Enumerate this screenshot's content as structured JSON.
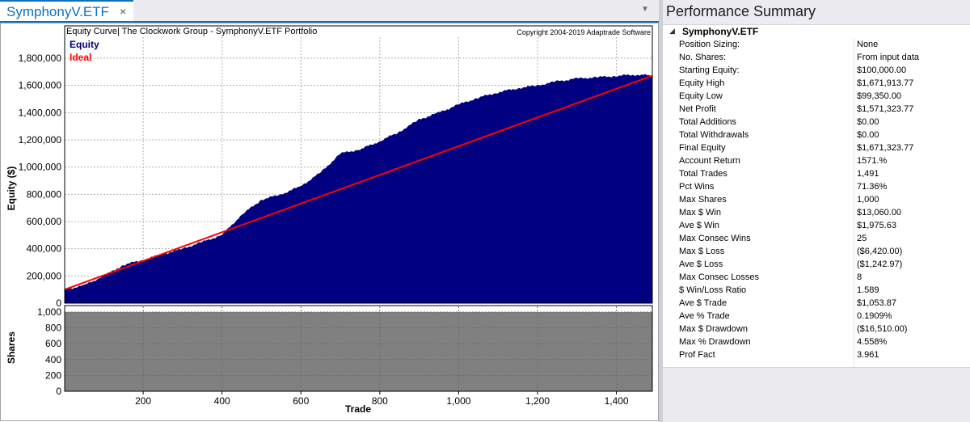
{
  "document_tab": {
    "title": "SymphonyV.ETF",
    "close_glyph": "×",
    "dropdown_glyph": "▼"
  },
  "colors": {
    "equity_fill": "#000080",
    "ideal_line": "#ff0000",
    "shares_fill": "#808080",
    "accent": "#0e70c0"
  },
  "chart_data": [
    {
      "type": "area",
      "title": "Equity Curve| The Clockwork Group - SymphonyV.ETF Portfolio",
      "copyright": "Copyright 2004-2019 Adaptrade Software",
      "xlabel": "",
      "ylabel": "Equity ($)",
      "xlim": [
        1,
        1491
      ],
      "ylim": [
        0,
        1800000
      ],
      "y_tick_labels": [
        "0",
        "200,000",
        "400,000",
        "600,000",
        "800,000",
        "1,000,000",
        "1,200,000",
        "1,400,000",
        "1,600,000",
        "1,800,000"
      ],
      "y_ticks": [
        0,
        200000,
        400000,
        600000,
        800000,
        1000000,
        1200000,
        1400000,
        1600000,
        1800000
      ],
      "grid": true,
      "legend": "top-left",
      "series": [
        {
          "name": "Equity",
          "x": [
            1,
            50,
            100,
            150,
            200,
            250,
            300,
            350,
            400,
            450,
            500,
            550,
            600,
            650,
            700,
            750,
            800,
            850,
            900,
            950,
            1000,
            1050,
            1100,
            1150,
            1200,
            1250,
            1300,
            1350,
            1400,
            1450,
            1491
          ],
          "values": [
            100000,
            130000,
            200000,
            280000,
            320000,
            360000,
            400000,
            450000,
            500000,
            650000,
            760000,
            800000,
            860000,
            960000,
            1100000,
            1130000,
            1190000,
            1260000,
            1350000,
            1400000,
            1460000,
            1510000,
            1550000,
            1580000,
            1600000,
            1630000,
            1650000,
            1660000,
            1670000,
            1680000,
            1671914
          ]
        },
        {
          "name": "Ideal",
          "x": [
            1,
            1491
          ],
          "values": [
            100000,
            1671324
          ]
        }
      ]
    },
    {
      "type": "area",
      "xlabel": "Trade",
      "ylabel": "Shares",
      "xlim": [
        1,
        1491
      ],
      "ylim": [
        0,
        1000
      ],
      "y_ticks": [
        0,
        200,
        400,
        600,
        800,
        1000
      ],
      "y_tick_labels": [
        "0",
        "200",
        "400",
        "600",
        "800",
        "1,000"
      ],
      "x_ticks": [
        200,
        400,
        600,
        800,
        1000,
        1200,
        1400
      ],
      "x_tick_labels": [
        "200",
        "400",
        "600",
        "800",
        "1,000",
        "1,200",
        "1,400"
      ],
      "grid": true,
      "series": [
        {
          "x": [
            1,
            1491
          ],
          "values": [
            1000,
            1000
          ]
        }
      ]
    }
  ],
  "summary": {
    "title": "Performance Summary",
    "collapse_glyph": "◢",
    "category": "SymphonyV.ETF",
    "rows": [
      {
        "key": "Position Sizing:",
        "value": "None"
      },
      {
        "key": "No. Shares:",
        "value": "From input data"
      },
      {
        "key": "Starting Equity:",
        "value": "$100,000.00"
      },
      {
        "key": "Equity High",
        "value": "$1,671,913.77"
      },
      {
        "key": "Equity Low",
        "value": "$99,350.00"
      },
      {
        "key": "Net Profit",
        "value": "$1,571,323.77"
      },
      {
        "key": "Total Additions",
        "value": "$0.00"
      },
      {
        "key": "Total Withdrawals",
        "value": "$0.00"
      },
      {
        "key": "Final Equity",
        "value": "$1,671,323.77"
      },
      {
        "key": "Account Return",
        "value": "1571.%"
      },
      {
        "key": "Total Trades",
        "value": "1,491"
      },
      {
        "key": "Pct Wins",
        "value": "71.36%"
      },
      {
        "key": "Max Shares",
        "value": "1,000"
      },
      {
        "key": "Max $ Win",
        "value": "$13,060.00"
      },
      {
        "key": "Ave $ Win",
        "value": "$1,975.63"
      },
      {
        "key": "Max Consec Wins",
        "value": "25"
      },
      {
        "key": "Max $ Loss",
        "value": "($6,420.00)"
      },
      {
        "key": "Ave $ Loss",
        "value": "($1,242.97)"
      },
      {
        "key": "Max Consec Losses",
        "value": "8"
      },
      {
        "key": "$ Win/Loss Ratio",
        "value": "1.589"
      },
      {
        "key": "Ave $ Trade",
        "value": "$1,053.87"
      },
      {
        "key": "Ave % Trade",
        "value": "0.1909%"
      },
      {
        "key": "Max $ Drawdown",
        "value": "($16,510.00)"
      },
      {
        "key": "Max % Drawdown",
        "value": "4.558%"
      },
      {
        "key": "Prof Fact",
        "value": "3.961"
      }
    ]
  }
}
